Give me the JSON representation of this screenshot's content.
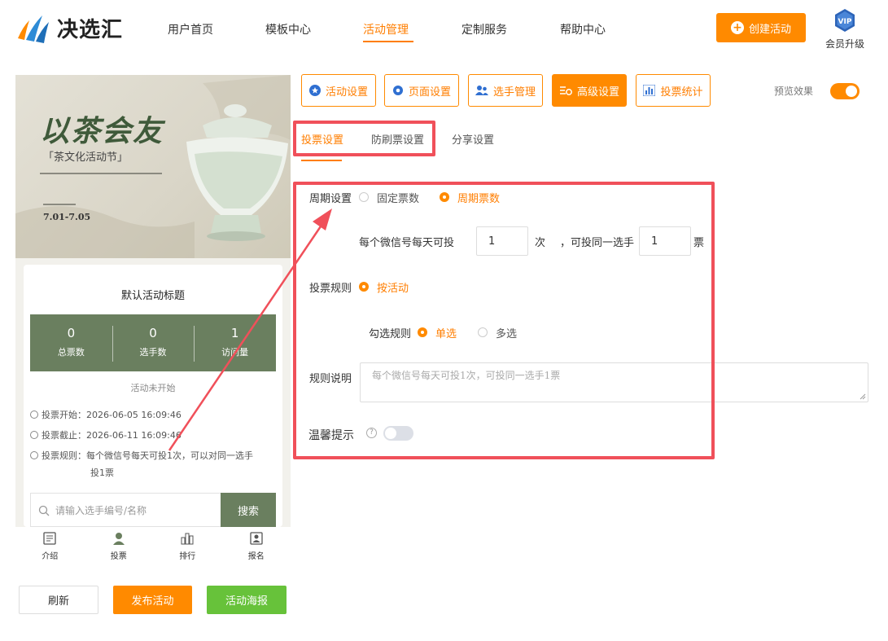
{
  "header": {
    "brand": "决选汇",
    "nav": [
      {
        "label": "用户首页"
      },
      {
        "label": "模板中心"
      },
      {
        "label": "活动管理"
      },
      {
        "label": "定制服务"
      },
      {
        "label": "帮助中心"
      }
    ],
    "create_label": "创建活动",
    "vip_badge": "VIP",
    "vip_label": "会员升级"
  },
  "preview": {
    "banner_title": "以茶会友",
    "banner_subtitle": "「茶文化活动节」",
    "banner_date": "7.01-7.05",
    "card_title": "默认活动标题",
    "stats": [
      {
        "value": "0",
        "label": "总票数"
      },
      {
        "value": "0",
        "label": "选手数"
      },
      {
        "value": "1",
        "label": "访问量"
      }
    ],
    "status": "活动未开始",
    "vote_start": "投票开始：2026-06-05 16:09:46",
    "vote_end": "投票截止：2026-06-11 16:09:46",
    "vote_rule": "投票规则：每个微信号每天可投1次，可以对同一选手",
    "vote_rule_2": "投1票",
    "search_placeholder": "请输入选手编号/名称",
    "search_button": "搜索",
    "tabs": [
      "介绍",
      "投票",
      "排行",
      "报名"
    ]
  },
  "actions": {
    "refresh": "刷新",
    "publish": "发布活动",
    "poster": "活动海报"
  },
  "toolbar": {
    "buttons": [
      "活动设置",
      "页面设置",
      "选手管理",
      "高级设置",
      "投票统计"
    ],
    "preview_label": "预览效果"
  },
  "subtabs": [
    "投票设置",
    "防刷票设置",
    "分享设置"
  ],
  "form": {
    "cycle_label": "周期设置",
    "cycle_options": [
      "固定票数",
      "周期票数"
    ],
    "per_wechat_label": "每个微信号每天可投",
    "per_wechat_value": "1",
    "times_unit": "次",
    "same_player_label": "，可投同一选手",
    "same_player_value": "1",
    "votes_unit": "票",
    "rule_label": "投票规则",
    "rule_option": "按活动",
    "check_label": "勾选规则",
    "check_options": [
      "单选",
      "多选"
    ],
    "desc_label": "规则说明",
    "desc_placeholder": "每个微信号每天可投1次，可投同一选手1票",
    "tip_label": "温馨提示",
    "help_icon": "?"
  },
  "colors": {
    "accent": "#ff8a00",
    "highlight": "#f0505a",
    "green": "#6a7f5f",
    "poster_green": "#67c23a"
  }
}
